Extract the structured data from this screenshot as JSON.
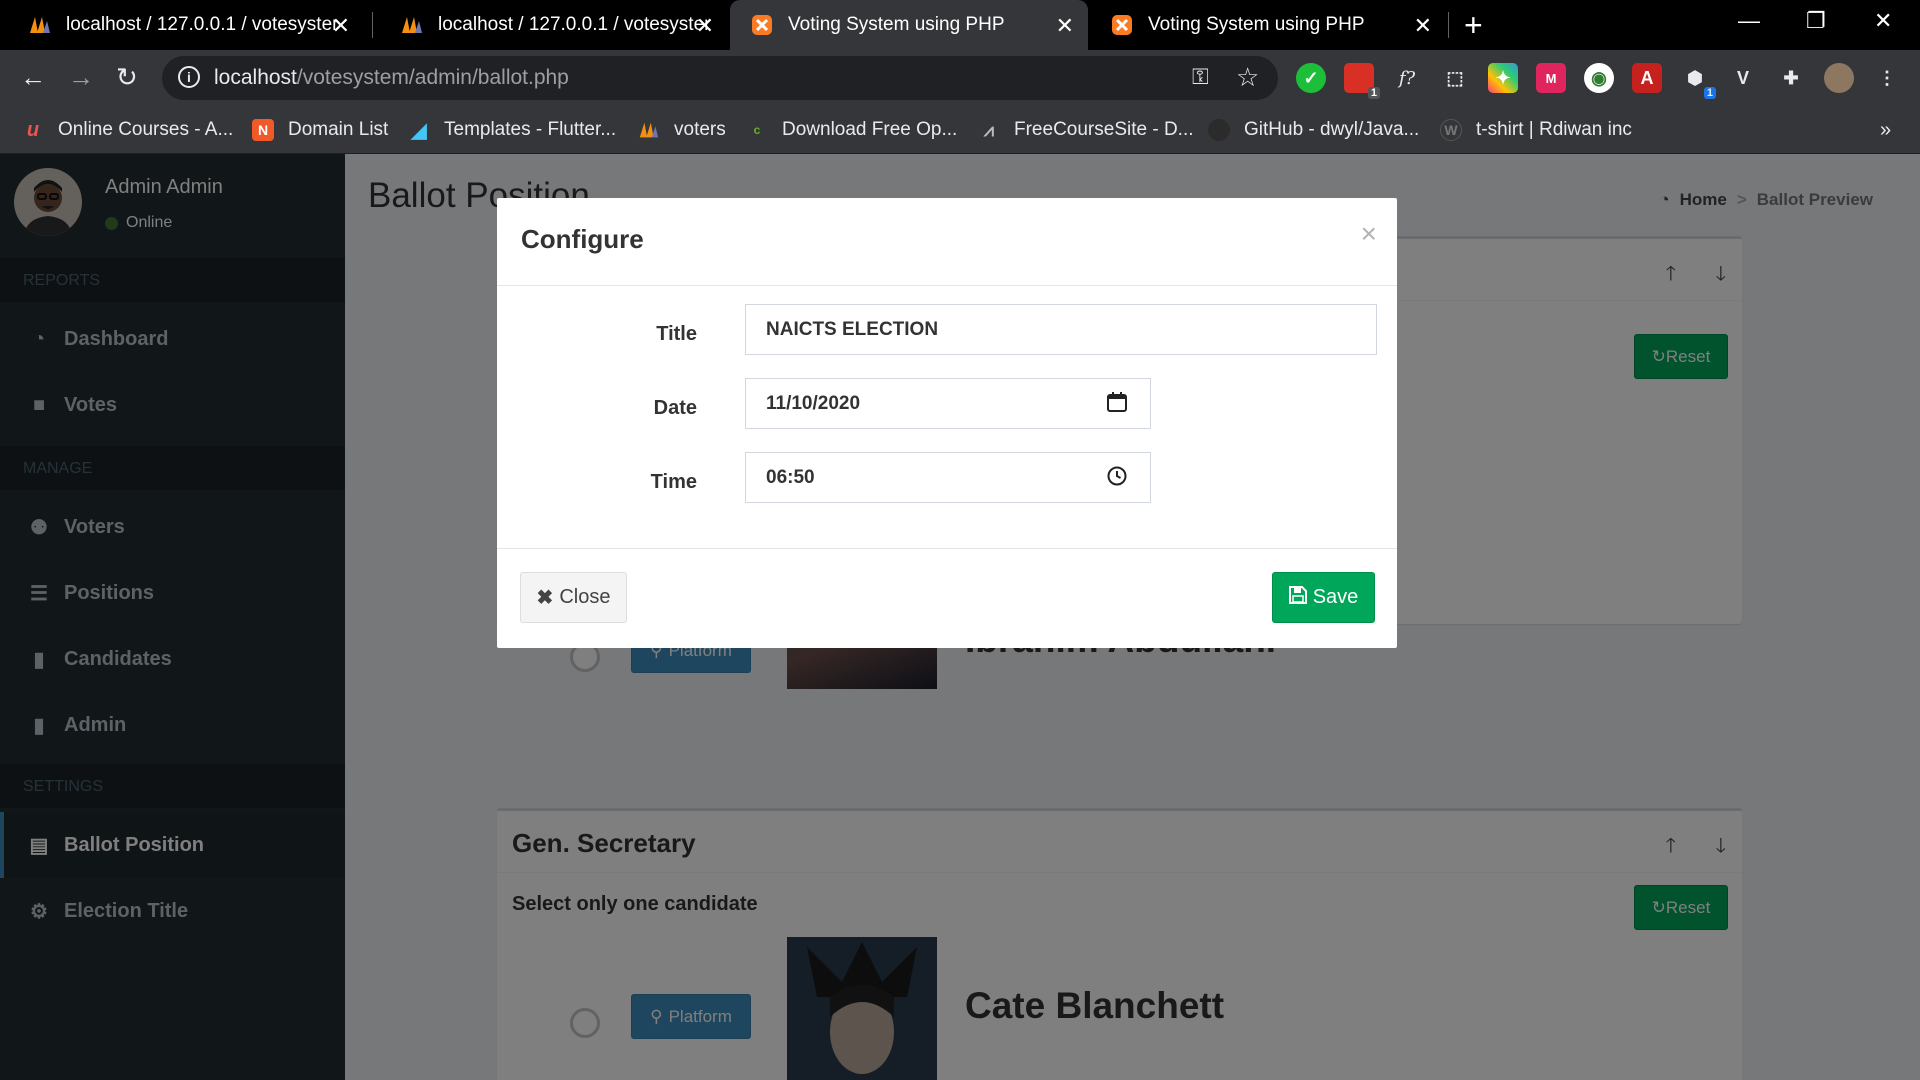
{
  "browser": {
    "tabs": [
      {
        "title": "localhost / 127.0.0.1 / votesystem",
        "active": false
      },
      {
        "title": "localhost / 127.0.0.1 / votesystem",
        "active": false
      },
      {
        "title": "Voting System using PHP",
        "active": true
      },
      {
        "title": "Voting System using PHP",
        "active": false
      }
    ],
    "url_host": "localhost",
    "url_path": "/votesystem/admin/ballot.php",
    "bookmarks": [
      {
        "label": "Online Courses - A...",
        "icon": "udemy-icon",
        "color": "#ec5252"
      },
      {
        "label": "Domain List",
        "icon": "domain-icon",
        "color": "#f05a28"
      },
      {
        "label": "Templates - Flutter...",
        "icon": "flutter-icon",
        "color": "#45c4f5"
      },
      {
        "label": "voters",
        "icon": "phpmyadmin-icon",
        "color": "#f29111"
      },
      {
        "label": "Download Free Op...",
        "icon": "c-icon",
        "color": "#6ab023"
      },
      {
        "label": "FreeCourseSite - D...",
        "icon": "fcs-icon",
        "color": "#bbbbbb"
      },
      {
        "label": "GitHub - dwyl/Java...",
        "icon": "github-icon",
        "color": "#333333"
      },
      {
        "label": "t-shirt | Rdiwan inc",
        "icon": "wp-icon",
        "color": "#464342"
      }
    ],
    "extension_badge_1": "1",
    "extension_badge_2": "1"
  },
  "sidebar": {
    "user_name": "Admin Admin",
    "user_status": "Online",
    "sections": {
      "reports": "REPORTS",
      "manage": "MANAGE",
      "settings": "SETTINGS"
    },
    "items": {
      "dashboard": "Dashboard",
      "votes": "Votes",
      "voters": "Voters",
      "positions": "Positions",
      "candidates": "Candidates",
      "admin": "Admin",
      "ballot_position": "Ballot Position",
      "election_title": "Election Title"
    }
  },
  "content": {
    "title": "Ballot Position",
    "breadcrumb_home": "Home",
    "breadcrumb_current": "Ballot Preview",
    "box1": {
      "reset": "Reset",
      "platform": "Platform",
      "candidate_name": "Ibrahim Abdullahi"
    },
    "box2": {
      "title": "Gen. Secretary",
      "note": "Select only one candidate",
      "reset": "Reset",
      "platform": "Platform",
      "candidate_name": "Cate Blanchett"
    }
  },
  "modal": {
    "title": "Configure",
    "title_label": "Title",
    "title_value": "NAICTS ELECTION",
    "date_label": "Date",
    "date_value": "11/10/2020",
    "time_label": "Time",
    "time_value": "06:50",
    "close_label": "Close",
    "save_label": "Save"
  },
  "colors": {
    "accent_green": "#00a65a",
    "accent_blue": "#3c8dbc",
    "sidebar_bg": "#222d32"
  }
}
